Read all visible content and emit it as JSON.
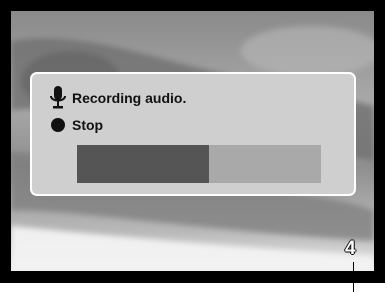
{
  "dialog": {
    "status_label": "Recording audio.",
    "status_icon": "microphone-icon",
    "stop_label": "Stop",
    "stop_icon": "filled-circle-icon"
  },
  "progress": {
    "fraction": 0.54
  },
  "callout": {
    "number": "4"
  },
  "colors": {
    "dialog_bg": "#cfcfcf",
    "progress_fill": "#555555",
    "progress_track": "#a9a9a9"
  }
}
